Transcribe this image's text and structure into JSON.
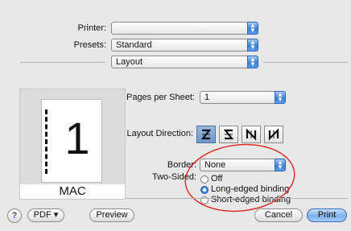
{
  "printer": {
    "label": "Printer:",
    "value": ""
  },
  "presets": {
    "label": "Presets:",
    "value": "Standard"
  },
  "panel": {
    "value": "Layout"
  },
  "preview": {
    "page_number": "1",
    "caption": "MAC"
  },
  "layout": {
    "pages_per_sheet": {
      "label": "Pages per Sheet:",
      "value": "1"
    },
    "direction": {
      "label": "Layout Direction:"
    },
    "border": {
      "label": "Border:",
      "value": "None"
    },
    "two_sided": {
      "label": "Two-Sided:",
      "options": [
        "Off",
        "Long-edged binding",
        "Short-edged binding"
      ],
      "selected": "Long-edged binding"
    }
  },
  "buttons": {
    "help": "?",
    "pdf": "PDF ▾",
    "preview": "Preview",
    "cancel": "Cancel",
    "print": "Print"
  },
  "colors": {
    "accent": "#3a7fd8",
    "annotation": "#e0231f"
  }
}
